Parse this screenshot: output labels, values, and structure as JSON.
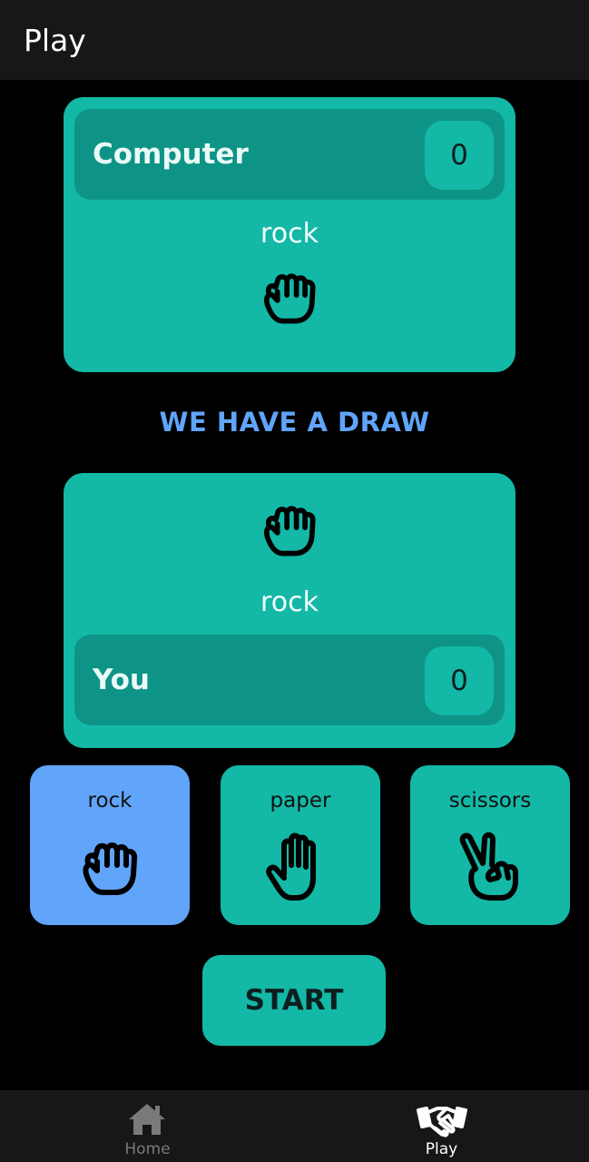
{
  "appbar": {
    "title": "Play"
  },
  "computer": {
    "name": "Computer",
    "score": "0",
    "choice": "rock",
    "choice_icon": "rock-hand-icon"
  },
  "status": {
    "message": "WE HAVE A DRAW"
  },
  "player": {
    "name": "You",
    "score": "0",
    "choice": "rock",
    "choice_icon": "rock-hand-icon"
  },
  "options": [
    {
      "label": "rock",
      "icon": "rock-hand-icon",
      "selected": true
    },
    {
      "label": "paper",
      "icon": "paper-hand-icon",
      "selected": false
    },
    {
      "label": "scissors",
      "icon": "scissors-hand-icon",
      "selected": false
    }
  ],
  "start_button": {
    "label": "START"
  },
  "bottom_nav": [
    {
      "label": "Home",
      "icon": "home-icon",
      "active": false
    },
    {
      "label": "Play",
      "icon": "handshake-icon",
      "active": true
    }
  ],
  "colors": {
    "background": "#000000",
    "card": "#14b8a6",
    "card_dark": "#0e9486",
    "accent_blue": "#60a5fa",
    "bar": "#171717"
  }
}
